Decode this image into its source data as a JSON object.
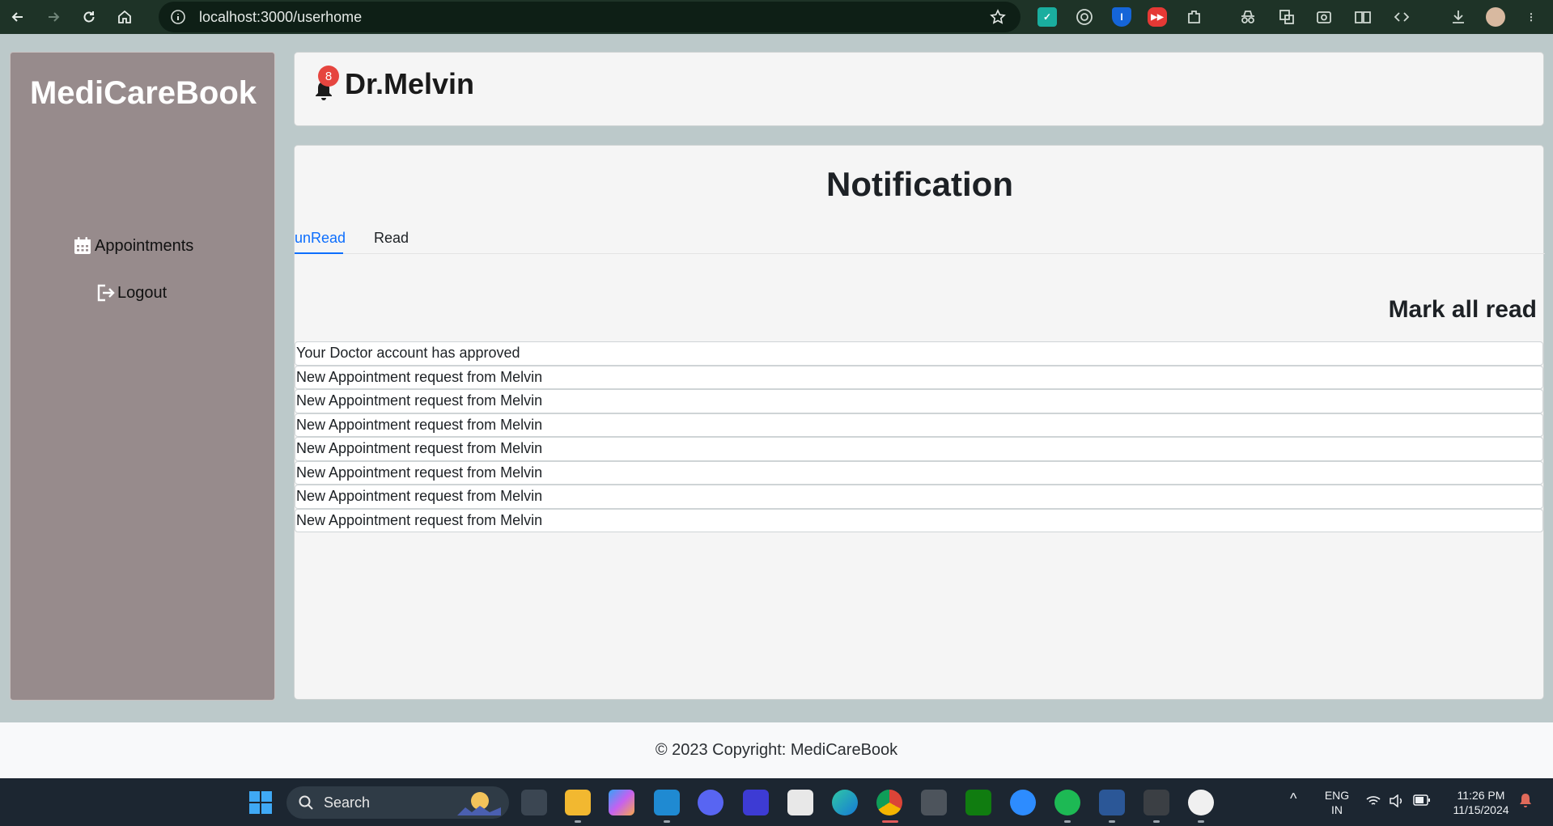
{
  "browser": {
    "url": "localhost:3000/userhome"
  },
  "sidebar": {
    "brand": "MediCareBook",
    "items": [
      {
        "label": "Appointments",
        "icon": "calendar-icon"
      },
      {
        "label": "Logout",
        "icon": "logout-icon"
      }
    ]
  },
  "header": {
    "notification_count": "8",
    "doctor_name": "Dr.Melvin"
  },
  "main": {
    "title": "Notification",
    "tabs": [
      {
        "label": "unRead",
        "active": true
      },
      {
        "label": "Read",
        "active": false
      }
    ],
    "mark_all_label": "Mark all read",
    "notifications": [
      "Your Doctor account has approved",
      "New Appointment request from Melvin",
      "New Appointment request from Melvin",
      "New Appointment request from Melvin",
      "New Appointment request from Melvin",
      "New Appointment request from Melvin",
      "New Appointment request from Melvin",
      "New Appointment request from Melvin"
    ]
  },
  "footer": {
    "copyright": "© 2023 Copyright: MediCareBook"
  },
  "taskbar": {
    "search_label": "Search",
    "language": "ENG",
    "region": "IN",
    "time": "11:26 PM",
    "date": "11/15/2024"
  },
  "colors": {
    "sidebar_bg": "#978b8c",
    "page_bg": "#bcc9ca",
    "accent": "#0d6efd",
    "badge": "#e6453f"
  }
}
